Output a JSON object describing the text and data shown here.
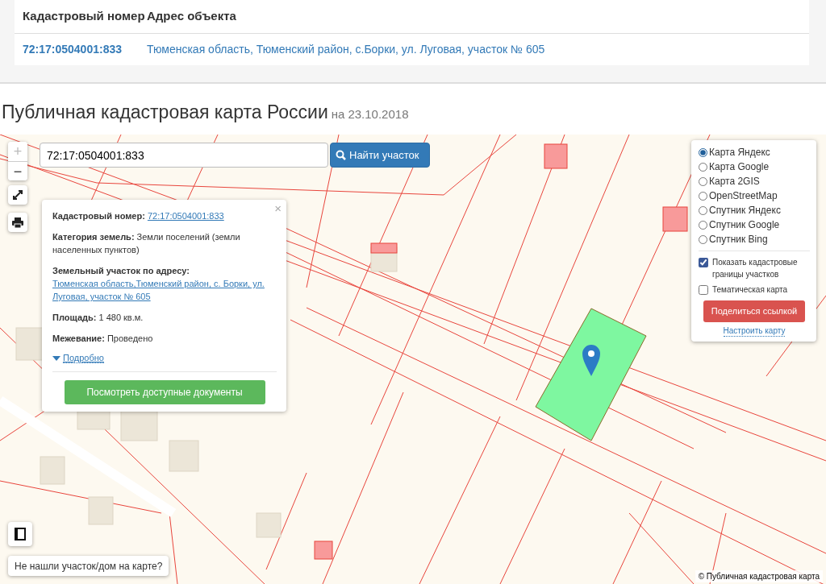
{
  "results_table": {
    "columns": [
      "Кадастровый номер",
      "Адрес объекта"
    ],
    "rows": [
      {
        "cadastral_number": "72:17:0504001:833",
        "address": "Тюменская область, Тюменский район, с.Борки, ул. Луговая, участок № 605"
      }
    ]
  },
  "page_title": {
    "title": "Публичная кадастровая карта России",
    "date": "на 23.10.2018"
  },
  "map": {
    "zoom_in": {
      "label": "+",
      "disabled": true
    },
    "zoom_out": {
      "label": "−",
      "disabled": false
    },
    "search": {
      "value": "72:17:0504001:833"
    },
    "search_button": "Найти участок",
    "info_popup": {
      "close": "×",
      "fields": [
        {
          "label": "Кадастровый номер:",
          "value": "72:17:0504001:833",
          "kind": "link"
        },
        {
          "label": "Категория земель:",
          "value": "Земли поселений (земли населенных пунктов)",
          "kind": "text"
        },
        {
          "label": "Земельный участок по адресу:",
          "value": "Тюменская область,Тюменский район, с. Борки, ул. Луговая, участок № 605",
          "kind": "link"
        },
        {
          "label": "Площадь:",
          "value": "1 480 кв.м.",
          "kind": "text"
        },
        {
          "label": "Межевание:",
          "value": "Проведено",
          "kind": "text"
        }
      ],
      "more_link": "Подробно",
      "documents_button": "Посмотреть доступные документы"
    },
    "layers": {
      "base_maps": [
        {
          "label": "Карта Яндекс",
          "selected": true
        },
        {
          "label": "Карта Google",
          "selected": false
        },
        {
          "label": "Карта 2GIS",
          "selected": false
        },
        {
          "label": "OpenStreetMap",
          "selected": false
        },
        {
          "label": "Спутник Яндекс",
          "selected": false
        },
        {
          "label": "Спутник Google",
          "selected": false
        },
        {
          "label": "Спутник Bing",
          "selected": false
        }
      ],
      "options": [
        {
          "label": "Показать кадастровые границы участков",
          "checked": true
        },
        {
          "label": "Тематическая карта",
          "checked": false
        }
      ],
      "share_button": "Поделиться ссылкой",
      "settings_link": "Настроить карту"
    },
    "not_found_button": "Не нашли участок/дом на карте?",
    "attribution": "© Публичная кадастровая карта"
  }
}
